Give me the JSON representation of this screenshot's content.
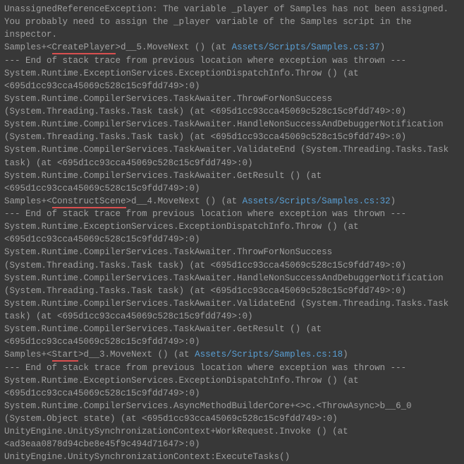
{
  "trace": {
    "line1": "UnassignedReferenceException: The variable _player of Samples has not been assigned.",
    "line2": "You probably need to assign the _player variable of the Samples script in the inspector.",
    "line3a": "Samples+<",
    "line3_underline": "CreatePlayer",
    "line3b": ">d__5.MoveNext () (at ",
    "line3_link": "Assets/Scripts/Samples.cs:37",
    "line3c": ")",
    "line4": "--- End of stack trace from previous location where exception was thrown ---",
    "line5": "System.Runtime.ExceptionServices.ExceptionDispatchInfo.Throw () (at <695d1cc93cca45069c528c15c9fdd749>:0)",
    "line6": "System.Runtime.CompilerServices.TaskAwaiter.ThrowForNonSuccess (System.Threading.Tasks.Task task) (at <695d1cc93cca45069c528c15c9fdd749>:0)",
    "line7": "System.Runtime.CompilerServices.TaskAwaiter.HandleNonSuccessAndDebuggerNotification (System.Threading.Tasks.Task task) (at <695d1cc93cca45069c528c15c9fdd749>:0)",
    "line8": "System.Runtime.CompilerServices.TaskAwaiter.ValidateEnd (System.Threading.Tasks.Task task) (at <695d1cc93cca45069c528c15c9fdd749>:0)",
    "line9": "System.Runtime.CompilerServices.TaskAwaiter.GetResult () (at <695d1cc93cca45069c528c15c9fdd749>:0)",
    "line10a": "Samples+<",
    "line10_underline": "ConstructScene",
    "line10b": ">d__4.MoveNext () (at ",
    "line10_link": "Assets/Scripts/Samples.cs:32",
    "line10c": ")",
    "line11": "--- End of stack trace from previous location where exception was thrown ---",
    "line12": "System.Runtime.ExceptionServices.ExceptionDispatchInfo.Throw () (at <695d1cc93cca45069c528c15c9fdd749>:0)",
    "line13": "System.Runtime.CompilerServices.TaskAwaiter.ThrowForNonSuccess (System.Threading.Tasks.Task task) (at <695d1cc93cca45069c528c15c9fdd749>:0)",
    "line14": "System.Runtime.CompilerServices.TaskAwaiter.HandleNonSuccessAndDebuggerNotification (System.Threading.Tasks.Task task) (at <695d1cc93cca45069c528c15c9fdd749>:0)",
    "line15": "System.Runtime.CompilerServices.TaskAwaiter.ValidateEnd (System.Threading.Tasks.Task task) (at <695d1cc93cca45069c528c15c9fdd749>:0)",
    "line16": "System.Runtime.CompilerServices.TaskAwaiter.GetResult () (at <695d1cc93cca45069c528c15c9fdd749>:0)",
    "line17a": "Samples+<",
    "line17_underline": "Start",
    "line17b": ">d__3.MoveNext () (at ",
    "line17_link": "Assets/Scripts/Samples.cs:18",
    "line17c": ")",
    "line18": "--- End of stack trace from previous location where exception was thrown ---",
    "line19": "System.Runtime.ExceptionServices.ExceptionDispatchInfo.Throw () (at <695d1cc93cca45069c528c15c9fdd749>:0)",
    "line20": "System.Runtime.CompilerServices.AsyncMethodBuilderCore+<>c.<ThrowAsync>b__6_0 (System.Object state) (at <695d1cc93cca45069c528c15c9fdd749>:0)",
    "line21": "UnityEngine.UnitySynchronizationContext+WorkRequest.Invoke () (at <ad3eaa0878d94cbe8e45f9c494d71647>:0)",
    "line22": "UnityEngine.UnitySynchronizationContext:ExecuteTasks()"
  }
}
